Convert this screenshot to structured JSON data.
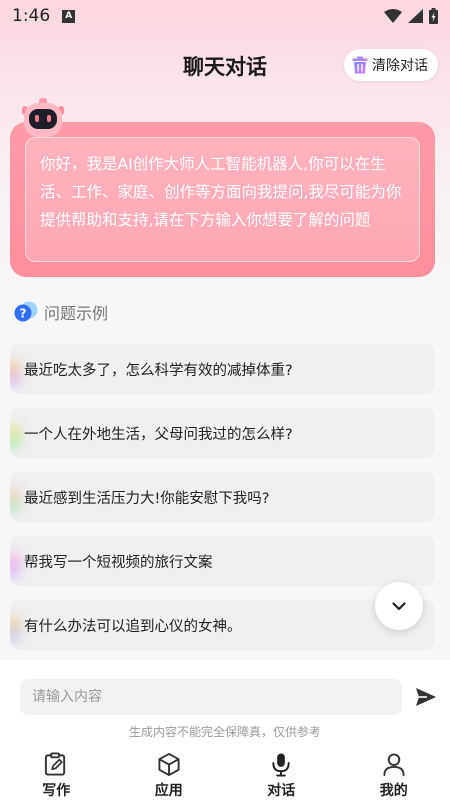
{
  "status_bar": {
    "time": "1:46",
    "notification_icon": "A"
  },
  "header": {
    "title": "聊天对话",
    "clear_label": "清除对话"
  },
  "welcome": {
    "message": "你好，我是AI创作大师人工智能机器人,你可以在生活、工作、家庭、创作等方面向我提问,我尽可能为你提供帮助和支持,请在下方输入你想要了解的问题"
  },
  "examples": {
    "title": "问题示例",
    "items": [
      {
        "text": "最近吃太多了，怎么科学有效的减掉体重?"
      },
      {
        "text": "一个人在外地生活，父母问我过的怎么样?"
      },
      {
        "text": "最近感到生活压力大!你能安慰下我吗?"
      },
      {
        "text": "帮我写一个短视频的旅行文案"
      },
      {
        "text": "有什么办法可以追到心仪的女神。"
      }
    ]
  },
  "input": {
    "placeholder": "请输入内容",
    "value": ""
  },
  "disclaimer": "生成内容不能完全保障真，仅供参考",
  "tabs": [
    {
      "label": "写作",
      "icon": "pen-icon"
    },
    {
      "label": "应用",
      "icon": "cube-icon"
    },
    {
      "label": "对话",
      "icon": "microphone-icon"
    },
    {
      "label": "我的",
      "icon": "user-icon"
    }
  ],
  "colors": {
    "accent": "#fd8e9d",
    "card_inner": "#ffb2bd",
    "background": "#f7f6f8"
  }
}
